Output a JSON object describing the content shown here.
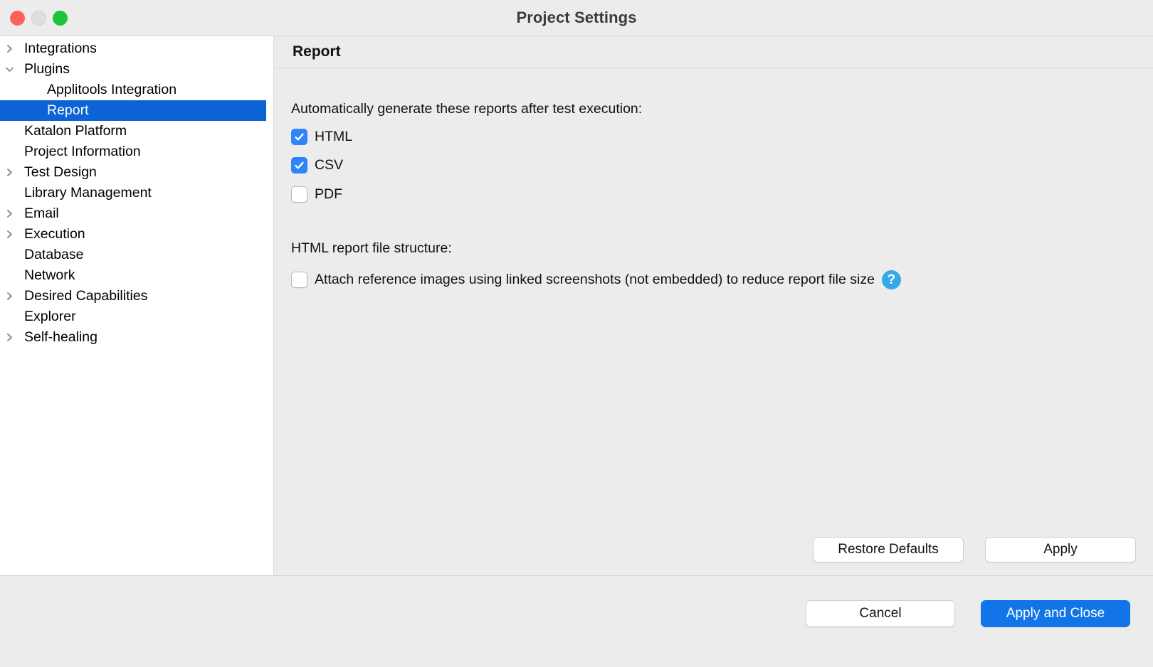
{
  "window": {
    "title": "Project Settings",
    "traffic_lights": [
      {
        "name": "close",
        "color": "#ff6259"
      },
      {
        "name": "minimize",
        "color": "#dedede"
      },
      {
        "name": "zoom",
        "color": "#1bc53c"
      }
    ]
  },
  "sidebar": {
    "items": [
      {
        "label": "Integrations",
        "depth": 0,
        "twisty": "collapsed",
        "selected": false
      },
      {
        "label": "Plugins",
        "depth": 0,
        "twisty": "expanded",
        "selected": false
      },
      {
        "label": "Applitools Integration",
        "depth": 1,
        "twisty": "none",
        "selected": false
      },
      {
        "label": "Report",
        "depth": 1,
        "twisty": "none",
        "selected": true
      },
      {
        "label": "Katalon Platform",
        "depth": 0,
        "twisty": "none",
        "selected": false
      },
      {
        "label": "Project Information",
        "depth": 0,
        "twisty": "none",
        "selected": false
      },
      {
        "label": "Test Design",
        "depth": 0,
        "twisty": "collapsed",
        "selected": false
      },
      {
        "label": "Library Management",
        "depth": 0,
        "twisty": "none",
        "selected": false
      },
      {
        "label": "Email",
        "depth": 0,
        "twisty": "collapsed",
        "selected": false
      },
      {
        "label": "Execution",
        "depth": 0,
        "twisty": "collapsed",
        "selected": false
      },
      {
        "label": "Database",
        "depth": 0,
        "twisty": "none",
        "selected": false
      },
      {
        "label": "Network",
        "depth": 0,
        "twisty": "none",
        "selected": false
      },
      {
        "label": "Desired Capabilities",
        "depth": 0,
        "twisty": "collapsed",
        "selected": false
      },
      {
        "label": "Explorer",
        "depth": 0,
        "twisty": "none",
        "selected": false
      },
      {
        "label": "Self-healing",
        "depth": 0,
        "twisty": "collapsed",
        "selected": false
      }
    ],
    "selection_color": "#0b63d6"
  },
  "content": {
    "title": "Report",
    "auto_generate": {
      "label": "Automatically generate these reports after test execution:",
      "options": [
        {
          "label": "HTML",
          "checked": true
        },
        {
          "label": "CSV",
          "checked": true
        },
        {
          "label": "PDF",
          "checked": false
        }
      ]
    },
    "file_structure": {
      "label": "HTML report file structure:",
      "attach_option": {
        "label": "Attach reference images using linked screenshots (not embedded) to reduce report file size",
        "checked": false
      },
      "help_icon": "help-question-icon",
      "help_glyph": "?"
    },
    "panel_buttons": {
      "restore_defaults": "Restore Defaults",
      "apply": "Apply"
    }
  },
  "footer": {
    "cancel": "Cancel",
    "apply_and_close": "Apply and Close"
  },
  "colors": {
    "accent_blue": "#1175e8",
    "checkbox_blue": "#2f84f7",
    "help_blue": "#35a9e8",
    "panel_gray": "#ececec"
  }
}
